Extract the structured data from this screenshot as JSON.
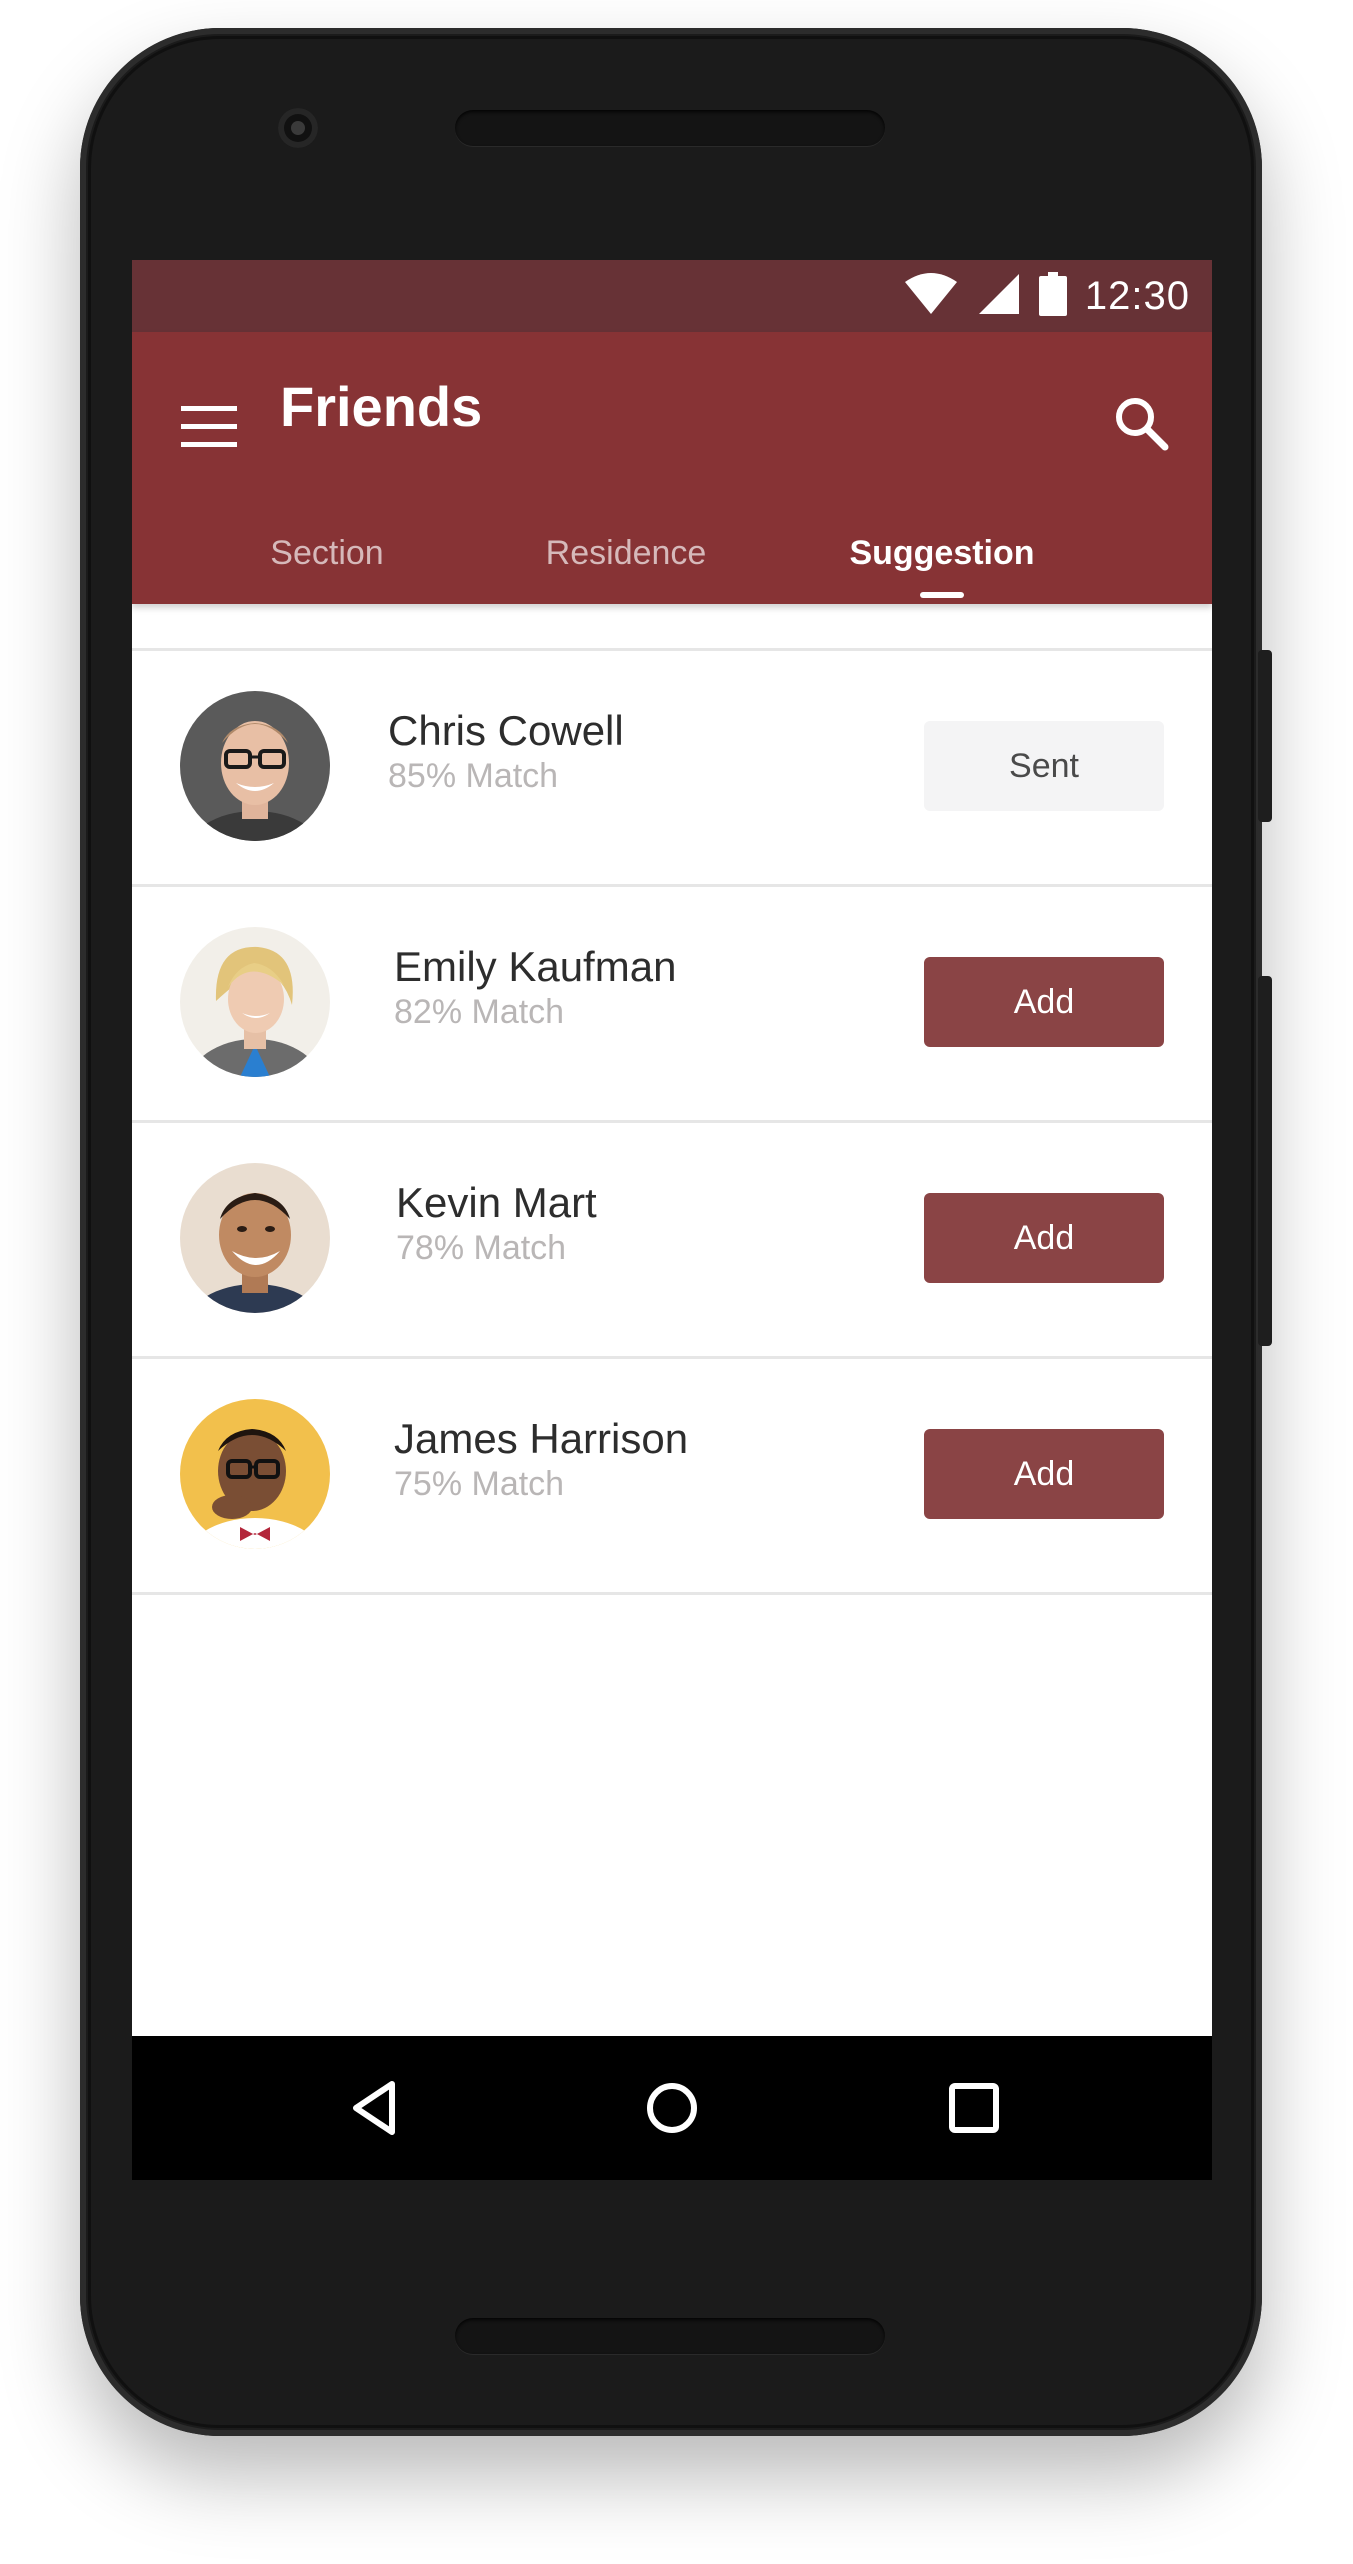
{
  "status_bar": {
    "time": "12:30"
  },
  "app_bar": {
    "title": "Friends",
    "accent_color": "#873335"
  },
  "tabs": [
    {
      "label": "Section",
      "active": false
    },
    {
      "label": "Residence",
      "active": false
    },
    {
      "label": "Suggestion",
      "active": true
    }
  ],
  "friends": [
    {
      "name": "Chris Cowell",
      "match": "85% Match",
      "action": "Sent"
    },
    {
      "name": "Emily Kaufman",
      "match": "82% Match",
      "action": "Add"
    },
    {
      "name": "Kevin Mart",
      "match": "78% Match",
      "action": "Add"
    },
    {
      "name": "James Harrison",
      "match": "75% Match",
      "action": "Add"
    }
  ],
  "nav_bar": {
    "icons": [
      "back-icon",
      "home-icon",
      "recents-icon"
    ]
  }
}
